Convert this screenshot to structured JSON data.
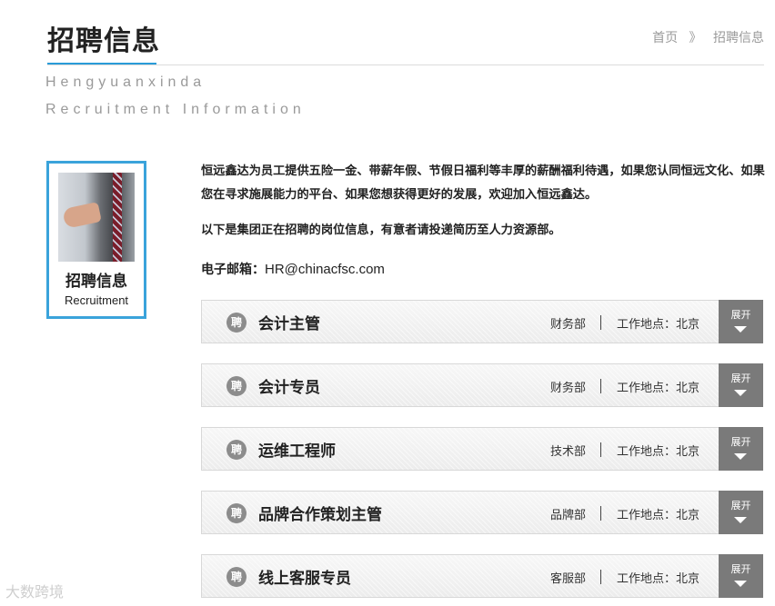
{
  "header": {
    "title": "招聘信息",
    "breadcrumb": [
      "首页",
      "》",
      "招聘信息"
    ],
    "subtitle_line1": "Hengyuanxinda",
    "subtitle_line2": "Recruitment Information"
  },
  "sidebar": {
    "card_title": "招聘信息",
    "card_subtitle": "Recruitment"
  },
  "intro": {
    "paragraph1": "恒远鑫达为员工提供五险一金、带薪年假、节假日福利等丰厚的薪酬福利待遇，如果您认同恒远文化、如果您在寻求施展能力的平台、如果您想获得更好的发展，欢迎加入恒远鑫达。",
    "paragraph2": "以下是集团正在招聘的岗位信息，有意者请投递简历至人力资源部。",
    "email_label": "电子邮箱：",
    "email_value": "HR@chinacfsc.com"
  },
  "jobs": [
    {
      "badge": "聘",
      "title": "会计主管",
      "dept": "财务部",
      "location": "工作地点：北京",
      "toggle": "展开"
    },
    {
      "badge": "聘",
      "title": "会计专员",
      "dept": "财务部",
      "location": "工作地点：北京",
      "toggle": "展开"
    },
    {
      "badge": "聘",
      "title": "运维工程师",
      "dept": "技术部",
      "location": "工作地点：北京",
      "toggle": "展开"
    },
    {
      "badge": "聘",
      "title": "品牌合作策划主管",
      "dept": "品牌部",
      "location": "工作地点：北京",
      "toggle": "展开"
    },
    {
      "badge": "聘",
      "title": "线上客服专员",
      "dept": "客服部",
      "location": "工作地点：北京",
      "toggle": "展开"
    }
  ],
  "watermark": "大数跨境",
  "colors": {
    "accent": "#3aa3db",
    "toggle_bg": "#7a7a7a",
    "muted_text": "#9a9a9a"
  }
}
